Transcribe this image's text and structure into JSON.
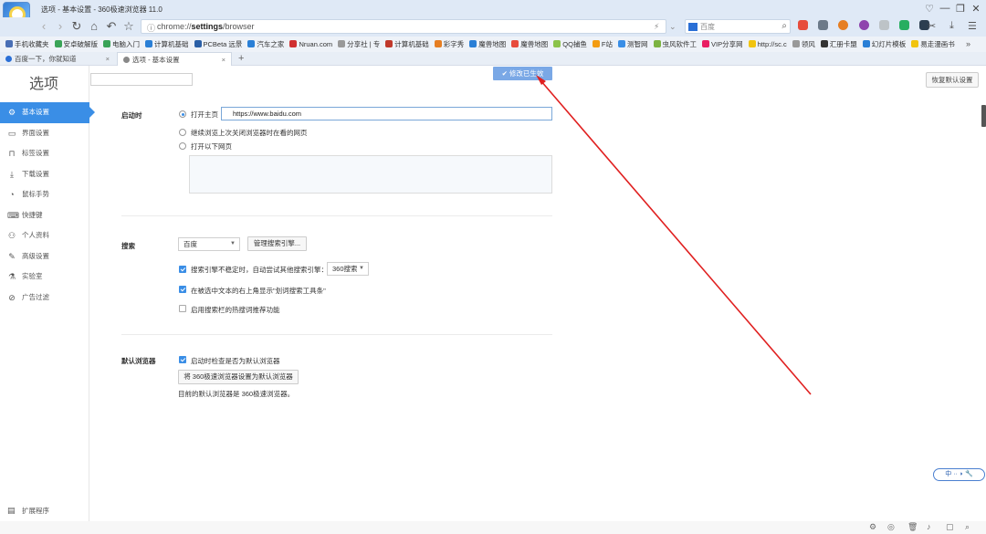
{
  "window": {
    "title": "选项 - 基本设置 - 360极速浏览器 11.0"
  },
  "toolbar": {
    "url_scheme": "chrome://",
    "url_host": "settings",
    "url_path": "/browser",
    "search_placeholder": "百度",
    "right_icon_1": "⚡",
    "right_icon_2": "⌄"
  },
  "bookmarks": [
    {
      "label": "手机收藏夹",
      "color": "#4a6fb5"
    },
    {
      "label": "安卓破解版",
      "color": "#3aa357"
    },
    {
      "label": "电脑入门",
      "color": "#3aa357"
    },
    {
      "label": "计算机基础",
      "color": "#2a7fd6"
    },
    {
      "label": "PCBeta 远景",
      "color": "#2a5fa6"
    },
    {
      "label": "汽车之家",
      "color": "#2a7fd6"
    },
    {
      "label": "Nruan.com",
      "color": "#d03030"
    },
    {
      "label": "分享社 | 专",
      "color": "#999999"
    },
    {
      "label": "计算机基础",
      "color": "#c0392b"
    },
    {
      "label": "彩字秀",
      "color": "#e67e22"
    },
    {
      "label": "魔兽地图",
      "color": "#2a7fd6"
    },
    {
      "label": "魔兽地图",
      "color": "#e74c3c"
    },
    {
      "label": "QQ捕鱼",
      "color": "#8bc34a"
    },
    {
      "label": "F站",
      "color": "#f39c12"
    },
    {
      "label": "测智网",
      "color": "#3a8ee6"
    },
    {
      "label": "虫风软件工",
      "color": "#7cb342"
    },
    {
      "label": "VIP分享网",
      "color": "#e91e63"
    },
    {
      "label": "http://sc.c",
      "color": "#f1c40f"
    },
    {
      "label": "领风",
      "color": "#999999"
    },
    {
      "label": "汇册卡盟",
      "color": "#333333"
    },
    {
      "label": "幻灯片模板",
      "color": "#2a7fd6"
    },
    {
      "label": "易走漫画书",
      "color": "#f1c40f"
    }
  ],
  "bookmarks_more": "»",
  "tabs": [
    {
      "label": "百度一下，你就知道",
      "close": "×"
    },
    {
      "label": "选项 - 基本设置",
      "close": "×"
    }
  ],
  "newtab": "+",
  "sidebar": {
    "title": "选项",
    "items": [
      {
        "label": "基本设置",
        "icon": "⚙",
        "active": true
      },
      {
        "label": "界面设置",
        "icon": "▭"
      },
      {
        "label": "标签设置",
        "icon": "⊓"
      },
      {
        "label": "下载设置",
        "icon": "⤓"
      },
      {
        "label": "鼠标手势",
        "icon": "◔"
      },
      {
        "label": "快捷键",
        "icon": "⌨"
      },
      {
        "label": "个人资料",
        "icon": "⚇"
      },
      {
        "label": "高级设置",
        "icon": "✎"
      },
      {
        "label": "实验室",
        "icon": "⚗"
      },
      {
        "label": "广告过滤",
        "icon": "⊘"
      }
    ],
    "extensions": "扩展程序"
  },
  "toast": "✔ 修改已生效",
  "restore_button": "恢复默认设置",
  "startup": {
    "label": "启动时",
    "opt1": "打开主页",
    "homepage_url": "https://www.baidu.com",
    "opt2": "继续浏览上次关闭浏览器时在看的网页",
    "opt3": "打开以下网页"
  },
  "search": {
    "label": "搜索",
    "engine": "百度",
    "manage_button": "管理搜索引擎...",
    "cb1": "搜索引擎不稳定时，自动尝试其他搜索引擎：",
    "fallback_engine": "360搜索",
    "cb2": "在被选中文本的右上角显示\"划词搜索工具条\"",
    "cb3": "启用搜索栏的热搜词推荐功能"
  },
  "default_browser": {
    "label": "默认浏览器",
    "cb1": "启动时检查是否为默认浏览器",
    "set_button": "将 360极速浏览器设置为默认浏览器",
    "status": "目前的默认浏览器是 360极速浏览器。"
  },
  "ime": "中 ·· ◗ 🔧",
  "colors": {
    "accent": "#3a8ee6",
    "arrow": "#e02020"
  }
}
